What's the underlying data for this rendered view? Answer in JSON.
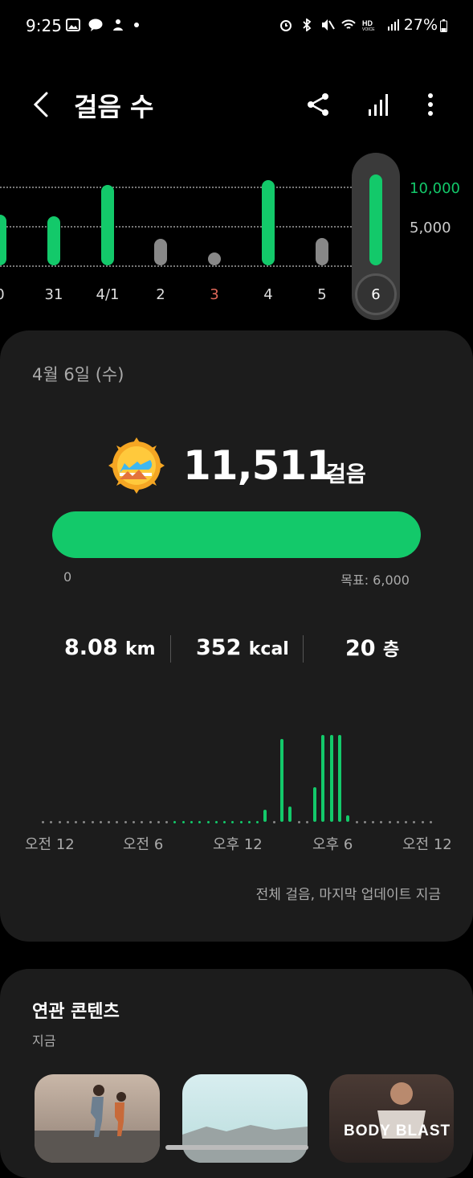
{
  "status_bar": {
    "time": "9:25",
    "battery": "27%",
    "icons": [
      "image-icon",
      "talk-icon",
      "person-icon",
      "dot-icon",
      "alarm-icon",
      "bluetooth-icon",
      "mute-icon",
      "wifi-icon",
      "hd-voice-icon",
      "signal-icon",
      "battery-icon"
    ]
  },
  "header": {
    "title": "걸음 수",
    "icons": [
      "back-icon",
      "share-icon",
      "chart-bars-icon",
      "more-icon"
    ]
  },
  "weekly_chart": {
    "y_ticks": [
      "10,000",
      "5,000"
    ],
    "days": [
      {
        "label": "0",
        "steps": 6400,
        "color": "#13c96a"
      },
      {
        "label": "31",
        "steps": 6200,
        "color": "#13c96a"
      },
      {
        "label": "4/1",
        "steps": 10200,
        "color": "#13c96a"
      },
      {
        "label": "2",
        "steps": 3400,
        "color": "#888888"
      },
      {
        "label": "3",
        "steps": 800,
        "color": "#888888",
        "label_color": "#e0685a"
      },
      {
        "label": "4",
        "steps": 10800,
        "color": "#13c96a"
      },
      {
        "label": "5",
        "steps": 3500,
        "color": "#888888"
      },
      {
        "label": "6",
        "steps": 11511,
        "color": "#13c96a",
        "selected": true
      }
    ]
  },
  "today": {
    "date": "4월 6일 (수)",
    "steps": "11,511",
    "steps_unit": "걸음",
    "progress_min": "0",
    "goal_label": "목표: 6,000",
    "progress_fraction": 1.0,
    "distance_value": "8.08",
    "distance_unit": "km",
    "calories_value": "352",
    "calories_unit": "kcal",
    "floors_value": "20",
    "floors_unit": "층",
    "timeline_labels": [
      "오전 12",
      "오전 6",
      "오후 12",
      "오후 6",
      "오전 12"
    ],
    "update_text": "전체 걸음, 마지막 업데이트 지금"
  },
  "chart_data": {
    "type": "bar",
    "x": [
      0,
      1,
      2,
      3,
      4,
      5,
      6,
      7,
      8,
      9,
      10,
      11,
      12,
      13,
      14,
      15,
      16,
      17,
      18,
      19,
      20,
      21,
      22,
      23,
      24,
      25,
      26,
      27,
      28,
      29,
      30,
      31,
      32,
      33,
      34,
      35,
      36,
      37,
      38,
      39,
      40,
      41,
      42,
      43,
      44,
      45,
      46,
      47
    ],
    "values": [
      0,
      0,
      0,
      0,
      0,
      0,
      0,
      0,
      0,
      0,
      0,
      0,
      0,
      0,
      0,
      0,
      0,
      0,
      0,
      0,
      0,
      0,
      0,
      0,
      0,
      0,
      0,
      1.5,
      0,
      10,
      1.8,
      0,
      0,
      4.2,
      10.5,
      10.5,
      10.5,
      0.8,
      0,
      0,
      0,
      0,
      0,
      0,
      0,
      0,
      0,
      0
    ],
    "xlabel": "",
    "ylabel": ""
  },
  "related": {
    "title": "연관 콘텐츠",
    "subtitle": "지금",
    "thumb_text": "BODY BLAST"
  }
}
